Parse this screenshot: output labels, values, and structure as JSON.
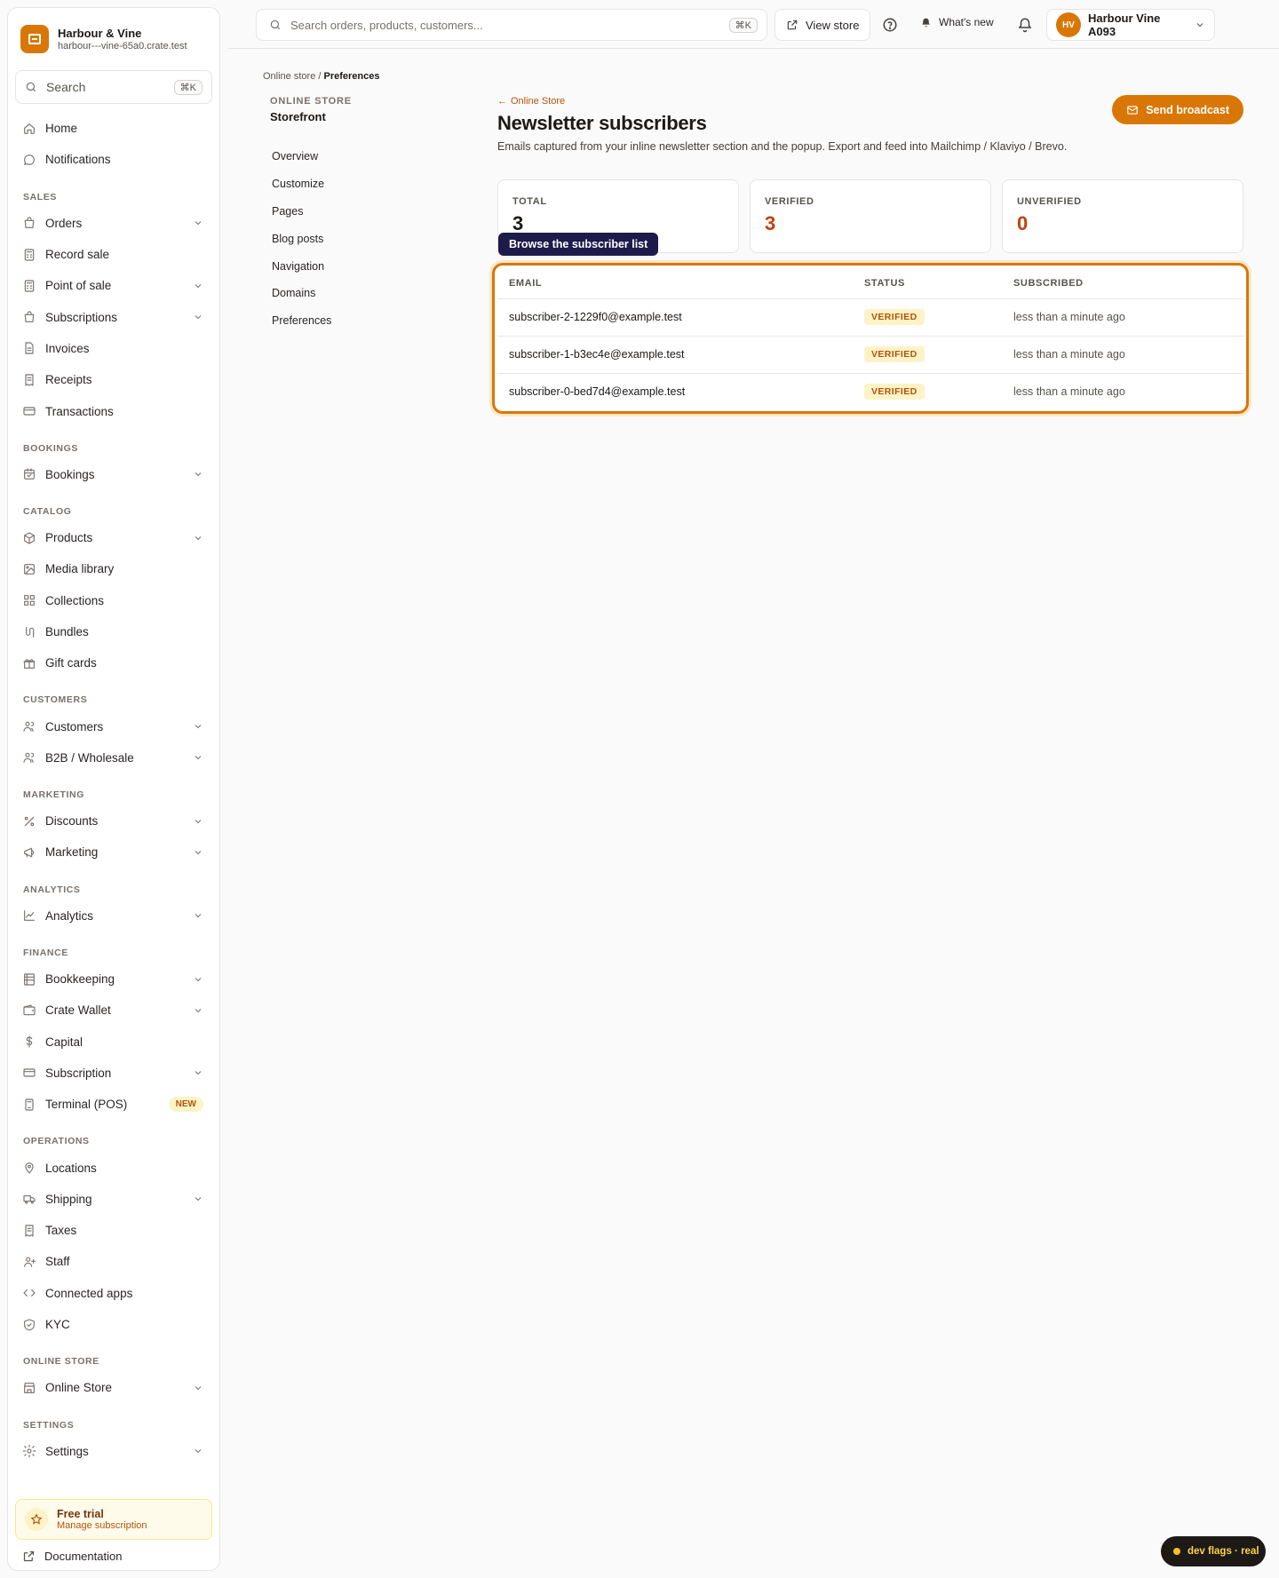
{
  "brand": {
    "name": "Harbour & Vine",
    "domain": "harbour---vine-65a0.crate.test"
  },
  "sidebar_search": {
    "label": "Search",
    "shortcut": "⌘K"
  },
  "sidebar": {
    "top": [
      {
        "label": "Home",
        "icon": "home-icon"
      },
      {
        "label": "Notifications",
        "icon": "chat-bubble-icon"
      }
    ],
    "sections": [
      {
        "title": "SALES",
        "items": [
          {
            "label": "Orders",
            "icon": "bag-icon",
            "chevron": true
          },
          {
            "label": "Record sale",
            "icon": "calculator-icon",
            "chevron": false
          },
          {
            "label": "Point of sale",
            "icon": "calculator-icon",
            "chevron": true
          },
          {
            "label": "Subscriptions",
            "icon": "bag-icon",
            "chevron": true
          },
          {
            "label": "Invoices",
            "icon": "document-icon",
            "chevron": false
          },
          {
            "label": "Receipts",
            "icon": "receipt-icon",
            "chevron": false
          },
          {
            "label": "Transactions",
            "icon": "card-icon",
            "chevron": false
          }
        ]
      },
      {
        "title": "BOOKINGS",
        "items": [
          {
            "label": "Bookings",
            "icon": "calendar-icon",
            "chevron": true
          }
        ]
      },
      {
        "title": "CATALOG",
        "items": [
          {
            "label": "Products",
            "icon": "cube-icon",
            "chevron": true
          },
          {
            "label": "Media library",
            "icon": "image-icon",
            "chevron": false
          },
          {
            "label": "Collections",
            "icon": "grid-icon",
            "chevron": false
          },
          {
            "label": "Bundles",
            "icon": "bundle-icon",
            "chevron": false
          },
          {
            "label": "Gift cards",
            "icon": "gift-icon",
            "chevron": false
          }
        ]
      },
      {
        "title": "CUSTOMERS",
        "items": [
          {
            "label": "Customers",
            "icon": "users-icon",
            "chevron": true
          },
          {
            "label": "B2B / Wholesale",
            "icon": "users-icon",
            "chevron": true
          }
        ]
      },
      {
        "title": "MARKETING",
        "items": [
          {
            "label": "Discounts",
            "icon": "percent-icon",
            "chevron": true
          },
          {
            "label": "Marketing",
            "icon": "megaphone-icon",
            "chevron": true
          }
        ]
      },
      {
        "title": "ANALYTICS",
        "items": [
          {
            "label": "Analytics",
            "icon": "chart-line-icon",
            "chevron": true
          }
        ]
      },
      {
        "title": "FINANCE",
        "items": [
          {
            "label": "Bookkeeping",
            "icon": "ledger-icon",
            "chevron": true
          },
          {
            "label": "Crate Wallet",
            "icon": "wallet-icon",
            "chevron": true
          },
          {
            "label": "Capital",
            "icon": "dollar-icon",
            "chevron": false
          },
          {
            "label": "Subscription",
            "icon": "card-icon",
            "chevron": true
          },
          {
            "label": "Terminal (POS)",
            "icon": "terminal-icon",
            "chevron": false,
            "badge": "NEW"
          }
        ]
      },
      {
        "title": "OPERATIONS",
        "items": [
          {
            "label": "Locations",
            "icon": "pin-icon",
            "chevron": false
          },
          {
            "label": "Shipping",
            "icon": "truck-icon",
            "chevron": true
          },
          {
            "label": "Taxes",
            "icon": "receipt-icon",
            "chevron": false
          },
          {
            "label": "Staff",
            "icon": "user-plus-icon",
            "chevron": false
          },
          {
            "label": "Connected apps",
            "icon": "code-icon",
            "chevron": false
          },
          {
            "label": "KYC",
            "icon": "shield-icon",
            "chevron": false
          }
        ]
      },
      {
        "title": "ONLINE STORE",
        "items": [
          {
            "label": "Online Store",
            "icon": "store-icon",
            "chevron": true
          }
        ]
      },
      {
        "title": "SETTINGS",
        "items": [
          {
            "label": "Settings",
            "icon": "gear-icon",
            "chevron": true
          }
        ]
      }
    ]
  },
  "trial": {
    "title": "Free trial",
    "subtitle": "Manage subscription"
  },
  "docs_label": "Documentation",
  "topbar": {
    "search_placeholder": "Search orders, products, customers...",
    "search_shortcut": "⌘K",
    "view_store": "View store",
    "whats_new": "What's new",
    "avatar_initials": "HV",
    "account_name": "Harbour Vine A093"
  },
  "breadcrumb": {
    "parent": "Online store",
    "sep": "/",
    "current": "Preferences"
  },
  "subnav": {
    "overline": "ONLINE STORE",
    "title": "Storefront",
    "items": [
      "Overview",
      "Customize",
      "Pages",
      "Blog posts",
      "Navigation",
      "Domains",
      "Preferences"
    ]
  },
  "page": {
    "back_link": "Online Store",
    "title": "Newsletter subscribers",
    "description": "Emails captured from your inline newsletter section and the popup. Export and feed into Mailchimp / Klaviyo / Brevo.",
    "send_broadcast": "Send broadcast"
  },
  "stats": [
    {
      "label": "TOTAL",
      "value": "3"
    },
    {
      "label": "VERIFIED",
      "value": "3"
    },
    {
      "label": "UNVERIFIED",
      "value": "0"
    }
  ],
  "tooltip": "Browse the subscriber list",
  "table": {
    "headers": [
      "EMAIL",
      "STATUS",
      "SUBSCRIBED"
    ],
    "rows": [
      {
        "email": "subscriber-2-1229f0@example.test",
        "status": "VERIFIED",
        "subscribed": "less than a minute ago"
      },
      {
        "email": "subscriber-1-b3ec4e@example.test",
        "status": "VERIFIED",
        "subscribed": "less than a minute ago"
      },
      {
        "email": "subscriber-0-bed7d4@example.test",
        "status": "VERIFIED",
        "subscribed": "less than a minute ago"
      }
    ]
  },
  "dev_flags": "dev flags · real",
  "colors": {
    "accent": "#d97706",
    "accent_dark": "#b45309",
    "tooltip_bg": "#1e1b4b"
  }
}
